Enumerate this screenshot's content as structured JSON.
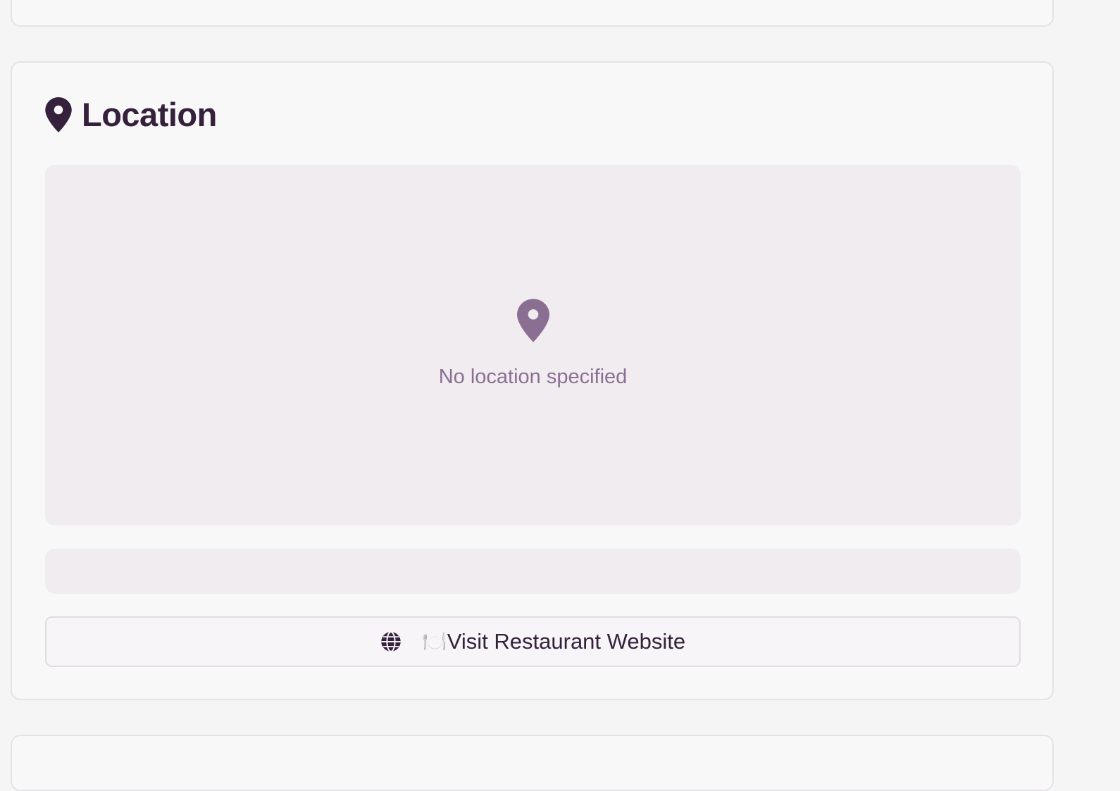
{
  "location_section": {
    "title": "Location",
    "map": {
      "empty_text": "No location specified",
      "icon": "map-pin-icon"
    },
    "address": "",
    "website_button": {
      "icon": "globe-icon",
      "emoji": "🍽️",
      "label": "Visit Restaurant Website"
    }
  },
  "colors": {
    "primary_text": "#35213b",
    "muted_pin": "#8b6f93",
    "panel_bg": "#f0ecf0",
    "card_bg": "#f9f8f9"
  }
}
